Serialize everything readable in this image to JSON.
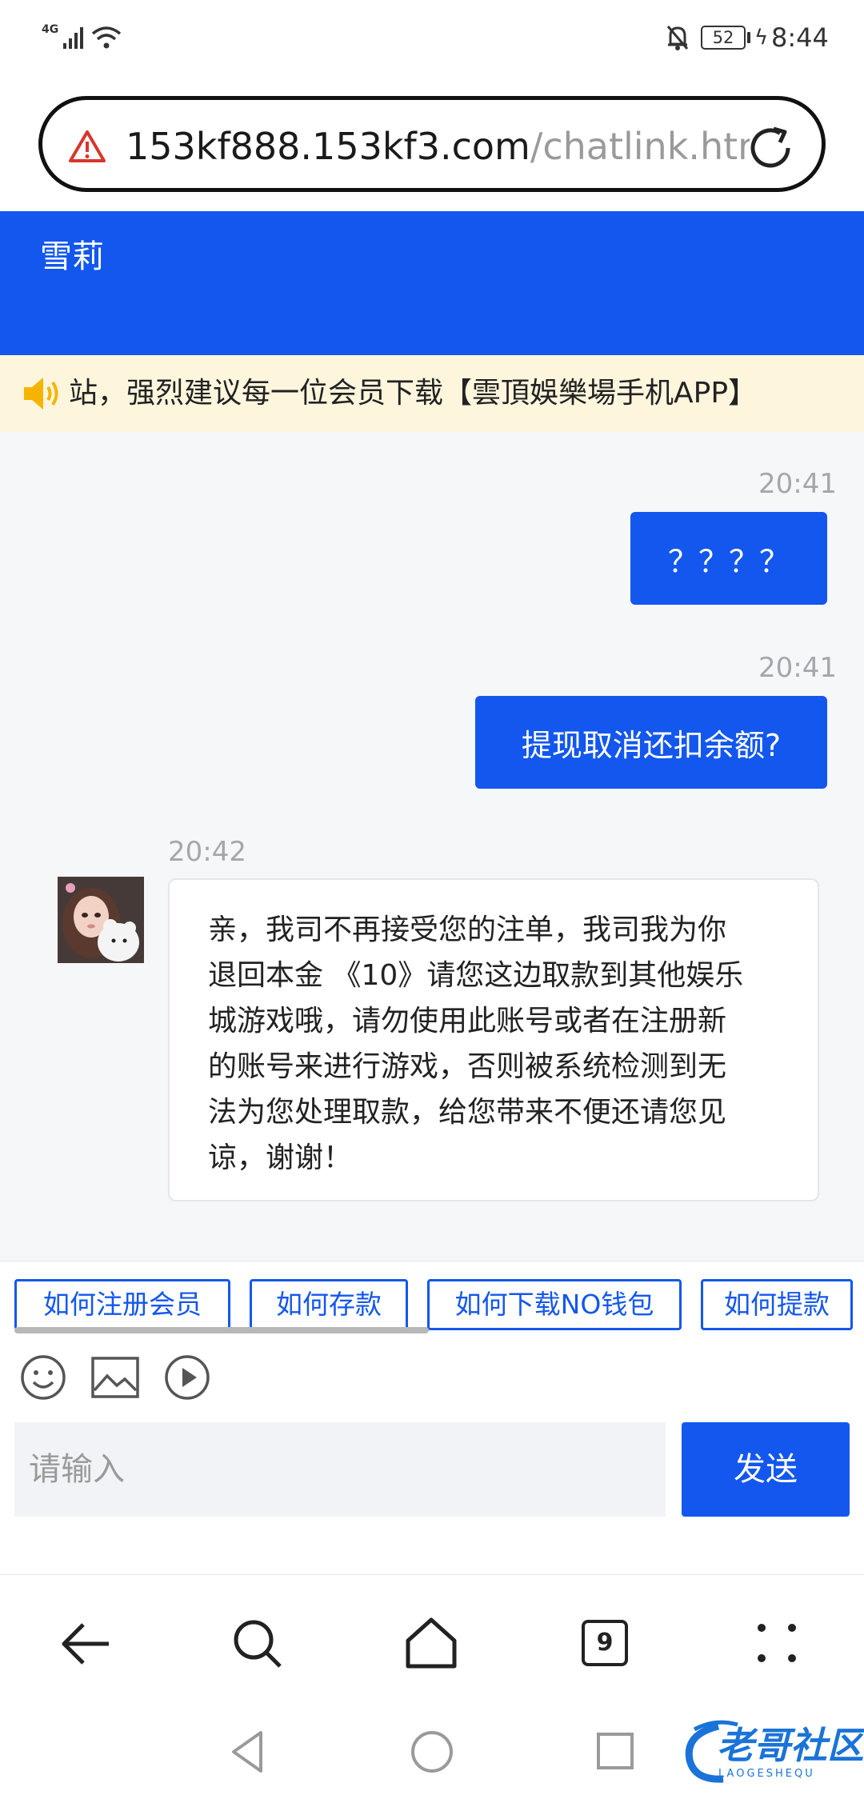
{
  "status_bar": {
    "network": "4G",
    "battery": "52",
    "time": "8:44"
  },
  "url_bar": {
    "domain": "153kf888.153kf3.com",
    "path": "/chatlink.htr"
  },
  "chat": {
    "title": "雪莉",
    "notice": "站，强烈建议每一位会员下载【雲頂娛樂場手机APP】",
    "messages": [
      {
        "direction": "out",
        "time": "20:41",
        "text": "？？？？"
      },
      {
        "direction": "out",
        "time": "20:41",
        "text": "提现取消还扣余额?"
      },
      {
        "direction": "in",
        "time": "20:42",
        "lines": [
          "亲，我司不再接受您的注单，我司我为你",
          "退回本金 《10》请您这边取款到其他娱乐",
          "城游戏哦，请勿使用此账号或者在注册新",
          "的账号来进行游戏，否则被系统检测到无",
          "法为您处理取款，给您带来不便还请您见",
          "谅，谢谢！"
        ]
      }
    ],
    "quick_replies": [
      "如何注册会员",
      "如何存款",
      "如何下载NO钱包",
      "如何提款"
    ],
    "toolbar_icons": [
      "emoji-icon",
      "image-icon",
      "video-icon"
    ],
    "input_placeholder": "请输入",
    "send_label": "发送"
  },
  "browser_nav": {
    "tab_count": "9",
    "icons": [
      "back-arrow-icon",
      "search-icon",
      "home-icon",
      "tabs-icon",
      "more-icon"
    ]
  },
  "system_nav": {
    "icons": [
      "triangle-back-icon",
      "circle-home-icon",
      "square-recents-icon"
    ]
  },
  "watermark": {
    "text": "老哥社区",
    "subtext": "LAOGESHEQU"
  },
  "colors": {
    "accent": "#1357ee",
    "notice_bg": "#fdf6dd",
    "chat_bg": "#f6f7f9"
  }
}
